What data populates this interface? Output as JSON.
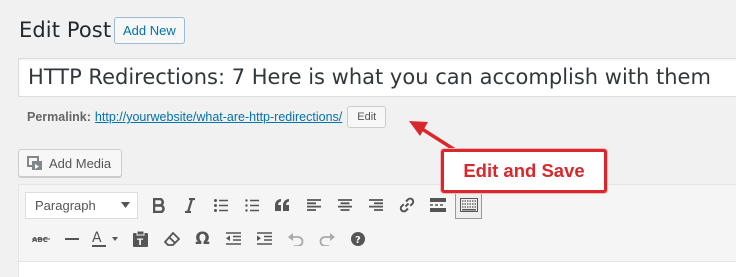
{
  "header": {
    "title": "Edit Post",
    "add_new_label": "Add New"
  },
  "post": {
    "title": "HTTP Redirections: 7 Here is what you can accomplish with them"
  },
  "permalink": {
    "label": "Permalink:",
    "url": "http://yourwebsite/what-are-http-redirections/",
    "edit_label": "Edit"
  },
  "annotation": {
    "text": "Edit and Save",
    "color": "#d9282c"
  },
  "media": {
    "add_media_label": "Add Media"
  },
  "toolbar": {
    "format_value": "Paragraph",
    "row1": [
      "bold-icon",
      "italic-icon",
      "bulleted-list-icon",
      "numbered-list-icon",
      "blockquote-icon",
      "align-left-icon",
      "align-center-icon",
      "align-right-icon",
      "insert-link-icon",
      "read-more-icon",
      "toolbar-toggle-icon"
    ],
    "row2": [
      "strikethrough-icon",
      "horizontal-line-icon",
      "text-color-icon",
      "paste-as-text-icon",
      "clear-formatting-icon",
      "special-character-icon",
      "decrease-indent-icon",
      "increase-indent-icon",
      "undo-icon",
      "redo-icon",
      "keyboard-shortcuts-icon"
    ]
  },
  "colors": {
    "link": "#0073aa",
    "accent_red": "#d9282c"
  }
}
